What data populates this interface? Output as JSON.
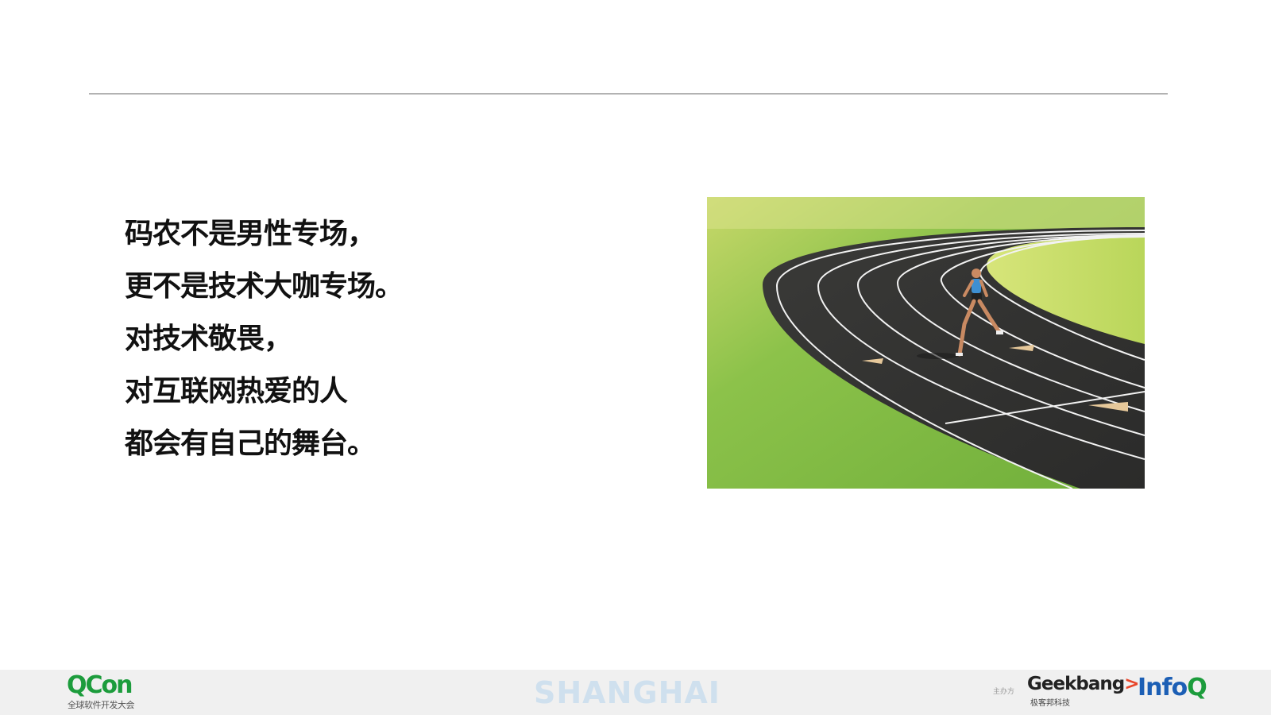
{
  "slide": {
    "lines": [
      "码农不是男性专场，",
      "更不是技术大咖专场。",
      "对技术敬畏，",
      "对互联网热爱的人",
      "都会有自己的舞台。"
    ],
    "photo_icon": "running-track-photo"
  },
  "footer": {
    "qcon_logo": "QCon",
    "qcon_subtitle": "全球软件开发大会",
    "city": "SHANGHAI",
    "organizer_label": "主办方",
    "geekbang_logo_main": "Geekbang",
    "geekbang_logo_arrow": ">.",
    "geekbang_subtitle": "极客邦科技",
    "infoq_logo_main": "Info",
    "infoq_logo_q": "Q"
  },
  "colors": {
    "qcon_green": "#1c9c3c",
    "city_text": "#cfe0ee",
    "infoq_blue": "#1c5fb5",
    "geekbang_arrow": "#e8462a",
    "rule": "#b2b2b2",
    "footer_bg": "#f0f0f0"
  }
}
